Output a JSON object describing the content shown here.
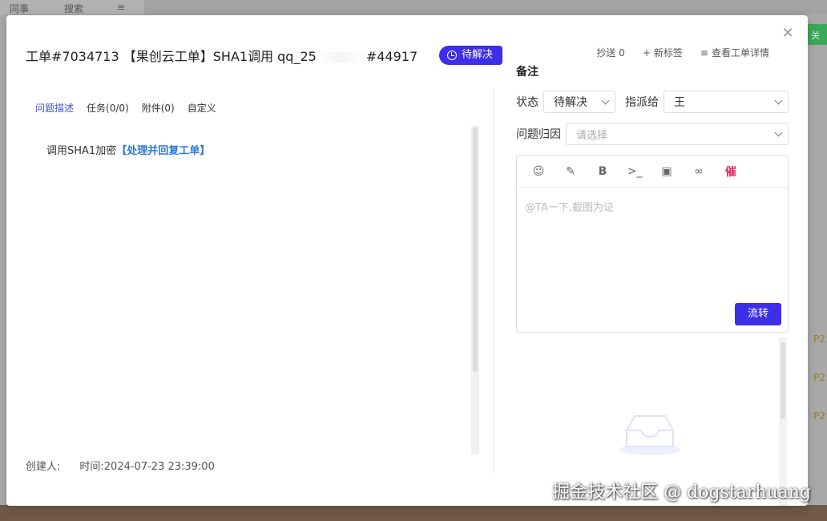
{
  "background": {
    "top_tabs": [
      "同事",
      "搜索"
    ],
    "right_button": "关",
    "priority_labels": [
      "P2",
      "P2",
      "P2"
    ]
  },
  "ticket": {
    "title_prefix": "工单#7034713 【果创云工单】SHA1调用 qq_25",
    "title_suffix": "#44917",
    "status_tag": "待解决"
  },
  "top_actions": {
    "cc": "抄送 0",
    "new_tag": "新标签",
    "view_detail": "查看工单详情"
  },
  "tabs": [
    {
      "label": "问题描述",
      "active": true
    },
    {
      "label": "任务(0/0)",
      "active": false
    },
    {
      "label": "附件(0)",
      "active": false
    },
    {
      "label": "自定义",
      "active": false
    }
  ],
  "description": {
    "text": "调用SHA1加密",
    "link": "【处理并回复工单】"
  },
  "meta": {
    "creator": "创建人:",
    "time": "时间:2024-07-23 23:39:00"
  },
  "panel": {
    "title": "备注",
    "status_label": "状态",
    "status_value": "待解决",
    "assign_label": "指派给",
    "assign_value": "王",
    "cause_label": "问题归因",
    "cause_placeholder": "请选择",
    "editor_placeholder": "@TA一下,截图为证",
    "urge": "催",
    "submit": "流转"
  },
  "watermark": "掘金技术社区 @ dogstarhuang",
  "colors": {
    "primary": "#3d2ee8",
    "link": "#2a7ad6",
    "urge": "#e0245e"
  }
}
